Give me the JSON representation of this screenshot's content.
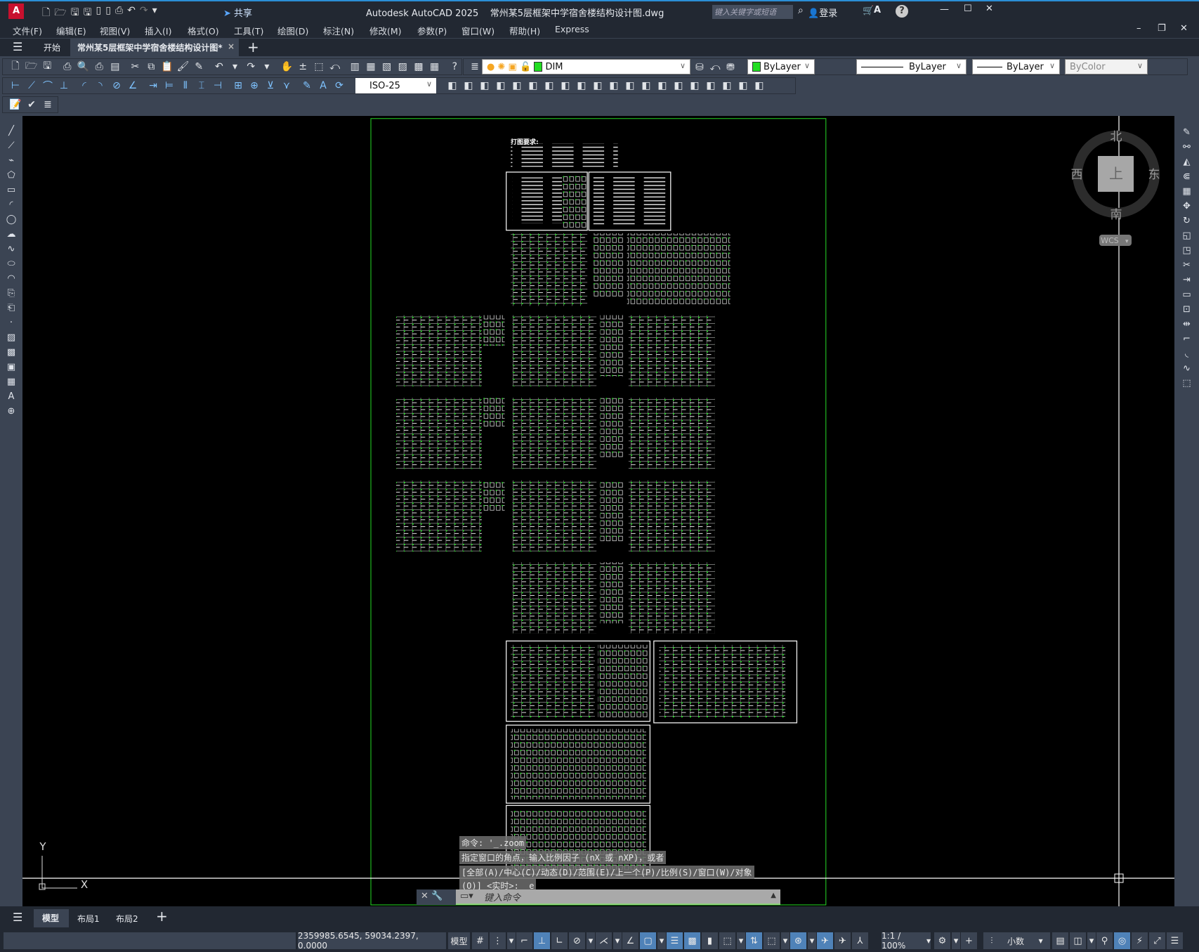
{
  "titlebar": {
    "app_title": "Autodesk AutoCAD 2025",
    "doc_title": "常州某5层框架中学宿舍楼结构设计图.dwg",
    "share_label": "共享",
    "search_placeholder": "键入关键字或短语",
    "login_label": "登录"
  },
  "menu": [
    "文件(F)",
    "编辑(E)",
    "视图(V)",
    "插入(I)",
    "格式(O)",
    "工具(T)",
    "绘图(D)",
    "标注(N)",
    "修改(M)",
    "参数(P)",
    "窗口(W)",
    "帮助(H)",
    "Express"
  ],
  "tabs": {
    "start": "开始",
    "active": "常州某5层框架中学宿舍楼结构设计图*"
  },
  "toolbar": {
    "layer": "DIM",
    "color": "ByLayer",
    "linetype": "ByLayer",
    "lineweight": "ByLayer",
    "plotstyle": "ByColor",
    "dimstyle": "ISO-25",
    "layer_color": "#22dd22"
  },
  "viewcube": {
    "north": "北",
    "south": "南",
    "east": "东",
    "west": "西",
    "face": "上",
    "ucs": "WCS"
  },
  "ucs_icon": {
    "x": "X",
    "y": "Y"
  },
  "drawing": {
    "note_title": "打图要求:"
  },
  "command": {
    "history": [
      "命令: '_.zoom",
      "指定窗口的角点，输入比例因子 (nX 或 nXP)，或者",
      "[全部(A)/中心(C)/动态(D)/范围(E)/上一个(P)/比例(S)/窗口(W)/对象",
      "(O)] <实时>: _e"
    ],
    "placeholder": "键入命令"
  },
  "layout_tabs": [
    "模型",
    "布局1",
    "布局2"
  ],
  "statusbar": {
    "coords": "2359985.6545, 59034.2397, 0.0000",
    "space": "模型",
    "scale": "1:1 / 100%",
    "units": "小数"
  }
}
